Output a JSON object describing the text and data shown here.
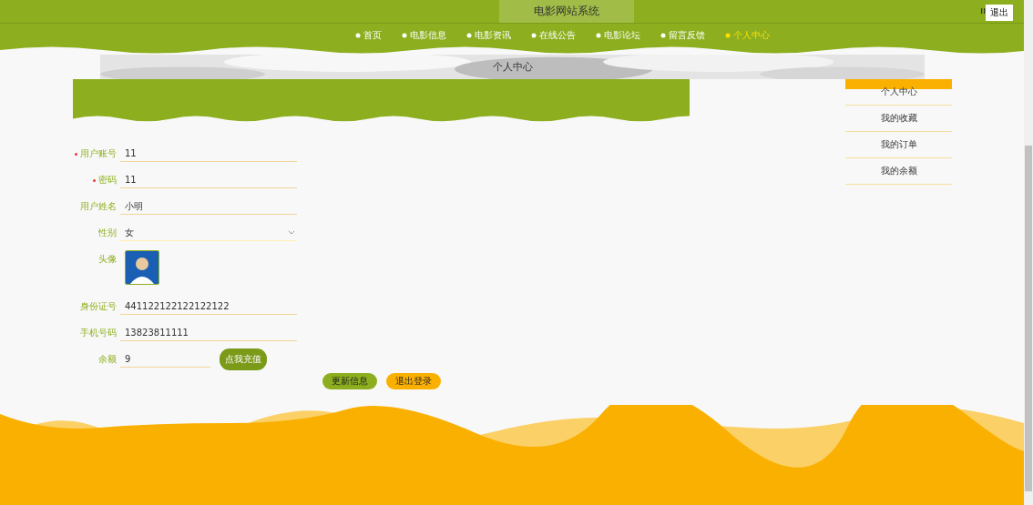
{
  "header": {
    "title": "电影网站系统",
    "logout": "退出"
  },
  "nav": [
    {
      "label": "首页",
      "selected": false
    },
    {
      "label": "电影信息",
      "selected": false
    },
    {
      "label": "电影资讯",
      "selected": false
    },
    {
      "label": "在线公告",
      "selected": false
    },
    {
      "label": "电影论坛",
      "selected": false
    },
    {
      "label": "留言反馈",
      "selected": false
    },
    {
      "label": "个人中心",
      "selected": true
    }
  ],
  "banner": {
    "title": "个人中心"
  },
  "sidebar": [
    {
      "label": "个人中心",
      "selected": true
    },
    {
      "label": "我的收藏",
      "selected": false
    },
    {
      "label": "我的订单",
      "selected": false
    },
    {
      "label": "我的余额",
      "selected": false
    }
  ],
  "fields": [
    {
      "kind": "text",
      "label": "用户账号",
      "required": true,
      "value": "11"
    },
    {
      "kind": "text",
      "label": "密码",
      "required": true,
      "value": "11"
    },
    {
      "kind": "text",
      "label": "用户姓名",
      "required": false,
      "value": "小明"
    },
    {
      "kind": "select",
      "label": "性别",
      "required": false,
      "value": "女"
    },
    {
      "label": "头像",
      "required": false
    },
    {
      "kind": "text",
      "label": "身份证号",
      "required": false,
      "value": "441122122122122122"
    },
    {
      "kind": "text",
      "label": "手机号码",
      "required": false,
      "value": "13823811111"
    },
    {
      "kind": "balance",
      "label": "余额",
      "required": false,
      "value": "9",
      "action": "点我充值"
    }
  ],
  "buttons": [
    {
      "label": "更新信息",
      "kind": "primary"
    },
    {
      "label": "退出登录",
      "kind": "secondary"
    }
  ]
}
